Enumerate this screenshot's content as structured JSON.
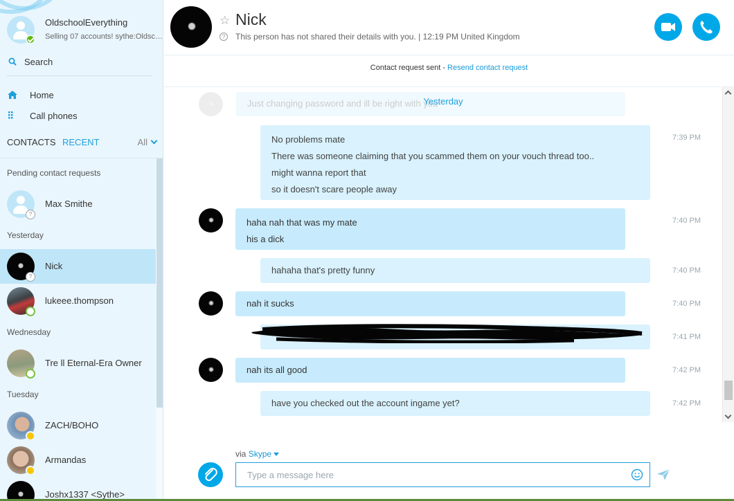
{
  "sidebar": {
    "profile": {
      "name": "OldschoolEverything",
      "mood": "Selling 07 accounts! sythe:OldschoolEverything"
    },
    "search_label": "Search",
    "nav": [
      {
        "label": "Home"
      },
      {
        "label": "Call phones"
      }
    ],
    "tabs": {
      "contacts": "CONTACTS",
      "recent": "RECENT",
      "filter": "All"
    },
    "sections": {
      "pending": "Pending contact requests",
      "yesterday": "Yesterday",
      "wednesday": "Wednesday",
      "tuesday": "Tuesday"
    },
    "contacts": [
      {
        "name": "Max Smithe"
      },
      {
        "name": "Nick"
      },
      {
        "name": "lukeee.thompson"
      },
      {
        "name": "Tre ll Eternal-Era Owner"
      },
      {
        "name": "ZACH/BOHO"
      },
      {
        "name": "Armandas"
      },
      {
        "name": "Joshx1337 <Sythe>"
      }
    ]
  },
  "chat": {
    "title": "Nick",
    "subtitle": "This person has not shared their details with you.  |  12:19 PM United Kingdom",
    "request_text": "Contact request sent - ",
    "request_link": "Resend contact request",
    "date_divider": "Yesterday",
    "faded_text": "Just changing password and ill be right with you",
    "messages": [
      {
        "lines": [
          "No problems mate",
          "There was someone claiming that you scammed them on your vouch thread too..",
          "might wanna report that",
          "so it doesn't scare people away"
        ],
        "time": "7:39 PM"
      },
      {
        "lines": [
          "haha nah that was my mate",
          "his a dick"
        ],
        "time": "7:40 PM"
      },
      {
        "lines": [
          "hahaha that's pretty funny"
        ],
        "time": "7:40 PM"
      },
      {
        "lines": [
          "nah it sucks"
        ],
        "time": "7:40 PM"
      },
      {
        "lines": [
          ""
        ],
        "time": "7:41 PM"
      },
      {
        "lines": [
          "nah its all good"
        ],
        "time": "7:42 PM"
      },
      {
        "lines": [
          "have you checked out the account ingame yet?"
        ],
        "time": "7:42 PM"
      }
    ]
  },
  "composer": {
    "via": "via ",
    "via_service": "Skype",
    "placeholder": "Type a message here"
  },
  "colors": {
    "accent": "#00a8e8",
    "bubble": "#c7ebfc",
    "sidebar": "#eaf6fd",
    "online": "#5fb800"
  },
  "icons": [
    "search-icon",
    "home-icon",
    "dialpad-icon",
    "star-icon",
    "info-icon",
    "video-call-icon",
    "phone-icon",
    "attach-icon",
    "emoji-icon",
    "send-icon"
  ]
}
